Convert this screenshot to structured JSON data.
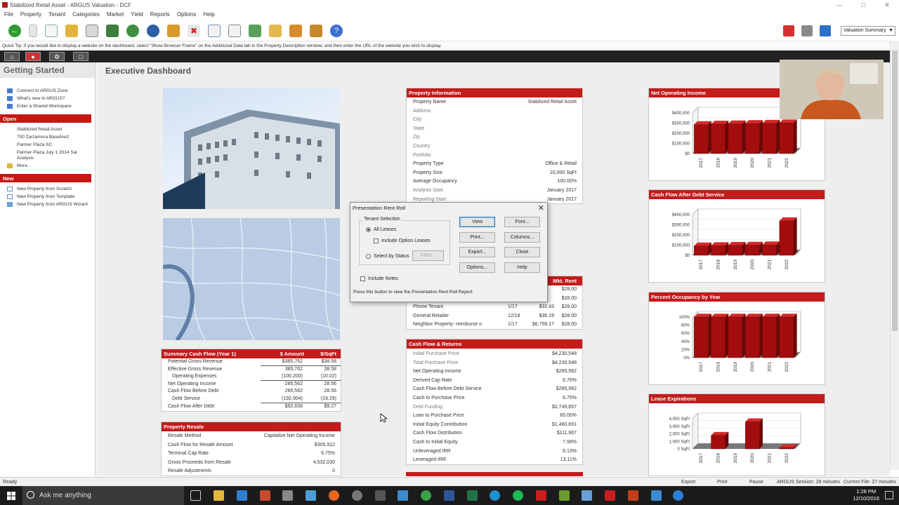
{
  "window": {
    "title": "Stabilized Retail Asset - ARGUS Valuation - DCF"
  },
  "menu": [
    "File",
    "Property",
    "Tenant",
    "Categories",
    "Market",
    "Yield",
    "Reports",
    "Options",
    "Help"
  ],
  "toolbar": {
    "view_select": "Valuation Summary"
  },
  "quick_tip": "Quick Tip: If you would like to display a website on the dashboard, select \"Show Browser Frame\" on the Additional Data tab in the Property Description window, and then enter the URL of the website you wish to display.",
  "sidebar": {
    "heading": "Getting Started",
    "top_links": [
      "Connect to ARGUS Zone",
      "What's new in ARGUS?",
      "Enter a Shared Workspace"
    ],
    "open_title": "Open",
    "open_items": [
      "Stabilized Retail Asset",
      "700 Zarzamora Baseline2",
      "Parmer Plaza SC",
      "Parmer Plaza July 1 2014 Sal Analysis",
      "More..."
    ],
    "new_title": "New",
    "new_items": [
      "New Property from Scratch",
      "New Property from Template",
      "New Property from ARGUS Wizard"
    ]
  },
  "page_title": "Executive Dashboard",
  "property_info": {
    "title": "Property Information",
    "rows": [
      [
        "Property Name",
        "Stabilized Retail Asset"
      ],
      [
        "Address",
        ""
      ],
      [
        "City",
        ""
      ],
      [
        "State",
        ""
      ],
      [
        "Zip",
        ""
      ],
      [
        "Country",
        ""
      ],
      [
        "Portfolio",
        ""
      ],
      [
        "Property Type",
        "Office & Retail"
      ],
      [
        "Property Size",
        "10,000 SqFt"
      ],
      [
        "Average Occupancy",
        "100.00%"
      ],
      [
        "Analysis Start",
        "January 2017"
      ],
      [
        "Reporting Start",
        "January 2017"
      ]
    ]
  },
  "rent_roll": {
    "header_right": "Mkt. Rent",
    "rows": [
      [
        "",
        "",
        "",
        "$28.00"
      ],
      [
        "",
        "",
        "",
        "$28.00"
      ],
      [
        "Phone Tenant",
        "1/17",
        "$32.43",
        "$28.00"
      ],
      [
        "General Retailer",
        "12/18",
        "$36.19",
        "$28.00"
      ],
      [
        "Neighbor Property- reimburse o",
        "1/17",
        "$6,756.17",
        "$28.00"
      ]
    ]
  },
  "summary_cf": {
    "title": "Summary Cash Flow (Year 1)",
    "col_amount": "$ Amount",
    "col_sqft": "$/SqFt",
    "rows": [
      [
        "Potential Gross Revenue",
        "$385,762",
        "$38.58"
      ],
      [
        "Effective Gross Revenue",
        "385,762",
        "38.58"
      ],
      [
        "Operating Expenses",
        "(100,200)",
        "(10.02)"
      ],
      [
        "Net Operating Income",
        "285,562",
        "28.56"
      ],
      [
        "Cash Flow Before Debt",
        "285,562",
        "28.56"
      ],
      [
        "Debt Service",
        "(192,904)",
        "(19.29)"
      ],
      [
        "Cash Flow After Debt",
        "$92,658",
        "$9.27"
      ]
    ]
  },
  "resale": {
    "title": "Property Resale",
    "rows": [
      [
        "Resale Method",
        "Capitalize Net Operating Income"
      ],
      [
        "Cash Flow for Resale Amount",
        "$305,912"
      ],
      [
        "Terminal Cap Rate",
        "6.75%"
      ],
      [
        "Gross Proceeds from Resale",
        "4,532,030"
      ],
      [
        "Resale Adjustments",
        "0"
      ]
    ]
  },
  "returns": {
    "title": "Cash Flow & Returns",
    "rows": [
      [
        "Initial Purchase Price",
        "$4,230,548"
      ],
      [
        "Total Purchase Price",
        "$4,230,548"
      ],
      [
        "Net Operating Income",
        "$285,562"
      ],
      [
        "Derived Cap Rate",
        "6.75%"
      ],
      [
        "Cash Flow Before Debt Service",
        "$285,562"
      ],
      [
        "Cash to Purchase Price",
        "6.75%"
      ],
      [
        "Debt Funding",
        "$2,749,857"
      ],
      [
        "Loan to Purchase Price",
        "65.00%"
      ],
      [
        "Initial Equity Contribution",
        "$1,480,691"
      ],
      [
        "Cash Flow Distribution",
        "$111,967"
      ],
      [
        "Cash to Initial Equity",
        "7.56%"
      ],
      [
        "Unleveraged IRR",
        "8.13%"
      ],
      [
        "Leveraged IRR",
        "13.11%"
      ]
    ]
  },
  "chart_data": [
    {
      "type": "bar",
      "title": "Net Operating Income",
      "categories": [
        "2017",
        "2018",
        "2019",
        "2020",
        "2021",
        "2022"
      ],
      "values": [
        285562,
        290000,
        293000,
        296000,
        299000,
        302000
      ],
      "yticks": [
        "$400,000",
        "$300,000",
        "$200,000",
        "$100,000",
        "$0"
      ],
      "ylim": [
        0,
        400000
      ],
      "color": "#a30d0d"
    },
    {
      "type": "bar",
      "title": "Cash Flow After Debt Service",
      "categories": [
        "2017",
        "2018",
        "2019",
        "2020",
        "2021",
        "2022"
      ],
      "values": [
        92658,
        95000,
        98000,
        100000,
        103000,
        340000
      ],
      "yticks": [
        "$400,000",
        "$300,000",
        "$200,000",
        "$100,000",
        "$0"
      ],
      "ylim": [
        0,
        400000
      ],
      "color": "#a30d0d"
    },
    {
      "type": "bar",
      "title": "Percent Occupancy by Year",
      "categories": [
        "2017",
        "2018",
        "2019",
        "2020",
        "2021",
        "2022"
      ],
      "values": [
        100,
        100,
        100,
        100,
        100,
        100
      ],
      "yticks": [
        "100%",
        "80%",
        "60%",
        "40%",
        "20%",
        "0%"
      ],
      "ylim": [
        0,
        100
      ],
      "color": "#a30d0d"
    },
    {
      "type": "bar",
      "title": "Lease Expirations",
      "categories": [
        "2017",
        "2018",
        "2019",
        "2020",
        "2021",
        "2022"
      ],
      "values": [
        0,
        1800,
        0,
        3600,
        0,
        150
      ],
      "yticks": [
        "4,000 SqFt",
        "3,000 SqFt",
        "2,000 SqFt",
        "1,000 SqFt",
        "0 SqFt"
      ],
      "ylim": [
        0,
        4000
      ],
      "color": "#a30d0d"
    }
  ],
  "dialog": {
    "title": "Presentation Rent Roll",
    "group_label": "Tenant Selection",
    "all_leases": "All Leases",
    "include_option": "Include Option Leases",
    "by_status": "Select by Status",
    "filter": "Filter...",
    "include_notes": "Include Notes",
    "hint": "Press this button to view the Presentation Rent Roll Report.",
    "buttons": {
      "view": "View",
      "font": "Font...",
      "print": "Print...",
      "columns": "Columns...",
      "export": "Export...",
      "close": "Close",
      "options": "Options...",
      "help": "Help"
    }
  },
  "status": {
    "ready": "Ready",
    "export": "Export",
    "print": "Print",
    "pause": "Pause",
    "session": "ARGUS Session: 28 minutes",
    "file": "Current File: 27 minutes"
  },
  "taskbar": {
    "search": "Ask me anything",
    "time": "1:28 PM",
    "date": "12/10/2016"
  }
}
